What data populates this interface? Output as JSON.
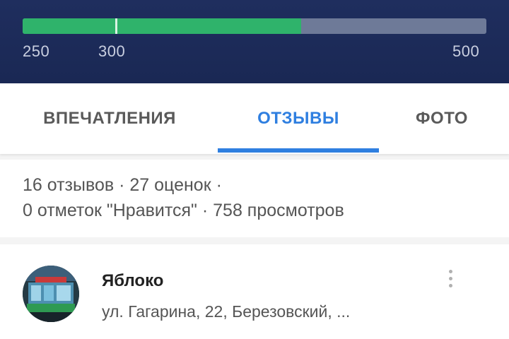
{
  "header": {
    "progress": {
      "min": 250,
      "max": 500,
      "value": 400,
      "marker": 300,
      "fill_color": "#2fb36b",
      "track_color": "#6e7a98",
      "labels": [
        "250",
        "300",
        "500"
      ]
    }
  },
  "tabs": [
    {
      "label": "ВПЕЧАТЛЕНИЯ",
      "active": false
    },
    {
      "label": "ОТЗЫВЫ",
      "active": true
    },
    {
      "label": "ФОТО",
      "active": false
    }
  ],
  "stats": {
    "line1": "16 отзывов · 27 оценок ·",
    "line2": "0 отметок \"Нравится\" · 758 просмотров"
  },
  "review": {
    "place_name": "Яблоко",
    "address": "ул. Гагарина, 22, Березовский, ...",
    "avatar_icon": "store-photo-icon",
    "menu_icon": "more-vert-icon"
  },
  "colors": {
    "header_bg": "#1f2e5e",
    "accent": "#2f7fe0"
  }
}
